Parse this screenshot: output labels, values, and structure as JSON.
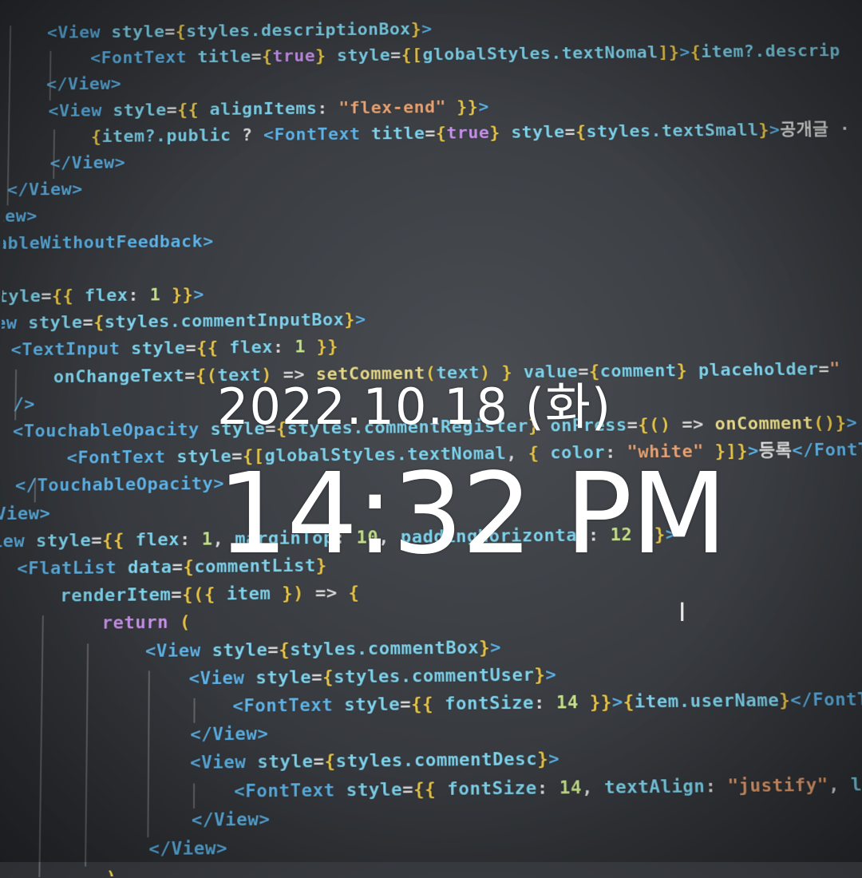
{
  "code_lines": [
    {
      "indent": 52,
      "parts": [
        [
          "tag",
          "<View "
        ],
        [
          "attr",
          "style"
        ],
        [
          "txt",
          "="
        ],
        [
          "brk",
          "{"
        ],
        [
          "attr",
          "styles.descriptionBox"
        ],
        [
          "brk",
          "}"
        ],
        [
          "tag",
          ">"
        ]
      ]
    },
    {
      "indent": 108,
      "parts": [
        [
          "tag",
          "<FontText "
        ],
        [
          "attr",
          "title"
        ],
        [
          "txt",
          "="
        ],
        [
          "brk",
          "{"
        ],
        [
          "kw",
          "true"
        ],
        [
          "brk",
          "}"
        ],
        [
          "txt",
          " "
        ],
        [
          "attr",
          "style"
        ],
        [
          "txt",
          "="
        ],
        [
          "brk",
          "{["
        ],
        [
          "attr",
          "globalStyles.textNomal"
        ],
        [
          "brk",
          "]}"
        ],
        [
          "tag",
          ">"
        ],
        [
          "brk",
          "{"
        ],
        [
          "attr",
          "item?.descrip"
        ]
      ]
    },
    {
      "indent": 52,
      "parts": [
        [
          "tag",
          "</View>"
        ]
      ]
    },
    {
      "indent": 55,
      "parts": [
        [
          "tag",
          "<View "
        ],
        [
          "attr",
          "style"
        ],
        [
          "txt",
          "="
        ],
        [
          "brk",
          "{{"
        ],
        [
          "attr",
          " alignItems"
        ],
        [
          "txt",
          ": "
        ],
        [
          "str",
          "\"flex-end\""
        ],
        [
          "brk",
          " }}"
        ],
        [
          "tag",
          ">"
        ]
      ]
    },
    {
      "indent": 110,
      "parts": [
        [
          "brk",
          "{"
        ],
        [
          "attr",
          "item?.public"
        ],
        [
          "txt",
          " ? "
        ],
        [
          "tag",
          "<FontText "
        ],
        [
          "attr",
          "title"
        ],
        [
          "txt",
          "="
        ],
        [
          "brk",
          "{"
        ],
        [
          "kw",
          "true"
        ],
        [
          "brk",
          "}"
        ],
        [
          "txt",
          " "
        ],
        [
          "attr",
          "style"
        ],
        [
          "txt",
          "="
        ],
        [
          "brk",
          "{"
        ],
        [
          "attr",
          "styles.textSmall"
        ],
        [
          "brk",
          "}"
        ],
        [
          "tag",
          ">"
        ],
        [
          "txt",
          "공개글 ·"
        ]
      ]
    },
    {
      "indent": 58,
      "parts": [
        [
          "tag",
          "</View>"
        ]
      ]
    },
    {
      "indent": 4,
      "parts": [
        [
          "tag",
          "</View>"
        ]
      ]
    },
    {
      "indent": -12,
      "parts": [
        [
          "tag",
          "iew>"
        ]
      ]
    },
    {
      "indent": -8,
      "parts": [
        [
          "tag",
          "ableWithoutFeedback>"
        ]
      ]
    },
    {
      "indent": 0,
      "parts": [
        [
          "txt",
          ""
        ]
      ]
    },
    {
      "indent": -6,
      "parts": [
        [
          "attr",
          "tyle"
        ],
        [
          "txt",
          "="
        ],
        [
          "brk",
          "{{"
        ],
        [
          "attr",
          " flex"
        ],
        [
          "txt",
          ": "
        ],
        [
          "num",
          "1"
        ],
        [
          "brk",
          " }}"
        ],
        [
          "tag",
          ">"
        ]
      ]
    },
    {
      "indent": -8,
      "parts": [
        [
          "tag",
          "ew "
        ],
        [
          "attr",
          "style"
        ],
        [
          "txt",
          "="
        ],
        [
          "brk",
          "{"
        ],
        [
          "attr",
          "styles.commentInputBox"
        ],
        [
          "brk",
          "}"
        ],
        [
          "tag",
          ">"
        ]
      ]
    },
    {
      "indent": 12,
      "parts": [
        [
          "tag",
          "<TextInput "
        ],
        [
          "attr",
          "style"
        ],
        [
          "txt",
          "="
        ],
        [
          "brk",
          "{{"
        ],
        [
          "attr",
          " flex"
        ],
        [
          "txt",
          ": "
        ],
        [
          "num",
          "1"
        ],
        [
          "brk",
          " }}"
        ]
      ]
    },
    {
      "indent": 66,
      "parts": [
        [
          "attr",
          "onChangeText"
        ],
        [
          "txt",
          "="
        ],
        [
          "brk",
          "{("
        ],
        [
          "attr",
          "text"
        ],
        [
          "brk",
          ")"
        ],
        [
          "txt",
          " => "
        ],
        [
          "fn",
          "setComment"
        ],
        [
          "brk",
          "("
        ],
        [
          "attr",
          "text"
        ],
        [
          "brk",
          ")"
        ],
        [
          "brk",
          " }"
        ],
        [
          "txt",
          " "
        ],
        [
          "attr",
          "value"
        ],
        [
          "txt",
          "="
        ],
        [
          "brk",
          "{"
        ],
        [
          "attr",
          "comment"
        ],
        [
          "brk",
          "}"
        ],
        [
          "txt",
          " "
        ],
        [
          "attr",
          "placeholder"
        ],
        [
          "txt",
          "="
        ],
        [
          "str",
          "\""
        ]
      ]
    },
    {
      "indent": 16,
      "parts": [
        [
          "tag",
          "/>"
        ]
      ]
    },
    {
      "indent": 16,
      "parts": [
        [
          "tag",
          "<TouchableOpacity "
        ],
        [
          "attr",
          "style"
        ],
        [
          "txt",
          "="
        ],
        [
          "brk",
          "{"
        ],
        [
          "attr",
          "styles.commentRegister"
        ],
        [
          "brk",
          "}"
        ],
        [
          "txt",
          " "
        ],
        [
          "attr",
          "onPress"
        ],
        [
          "txt",
          "="
        ],
        [
          "brk",
          "{()"
        ],
        [
          "txt",
          " => "
        ],
        [
          "fn",
          "onComment"
        ],
        [
          "brk",
          "()}"
        ],
        [
          "tag",
          ">"
        ]
      ]
    },
    {
      "indent": 84,
      "parts": [
        [
          "tag",
          "<FontText "
        ],
        [
          "attr",
          "style"
        ],
        [
          "txt",
          "="
        ],
        [
          "brk",
          "{["
        ],
        [
          "attr",
          "globalStyles.textNomal"
        ],
        [
          "txt",
          ", "
        ],
        [
          "brk",
          "{"
        ],
        [
          "attr",
          " color"
        ],
        [
          "txt",
          ": "
        ],
        [
          "str",
          "\"white\""
        ],
        [
          "brk",
          " }]}"
        ],
        [
          "tag",
          ">"
        ],
        [
          "txt",
          "등록"
        ],
        [
          "tag",
          "</FontTex"
        ]
      ]
    },
    {
      "indent": 20,
      "parts": [
        [
          "tag",
          "</TouchableOpacity>"
        ]
      ]
    },
    {
      "indent": -4,
      "parts": [
        [
          "tag",
          "View>"
        ]
      ]
    },
    {
      "indent": -8,
      "parts": [
        [
          "tag",
          "iew "
        ],
        [
          "attr",
          "style"
        ],
        [
          "txt",
          "="
        ],
        [
          "brk",
          "{{"
        ],
        [
          "attr",
          " flex"
        ],
        [
          "txt",
          ": "
        ],
        [
          "num",
          "1"
        ],
        [
          "txt",
          ", "
        ],
        [
          "attr",
          "marginTop"
        ],
        [
          "txt",
          ": "
        ],
        [
          "num",
          "10"
        ],
        [
          "txt",
          ", "
        ],
        [
          "attr",
          "paddingHorizontal"
        ],
        [
          "txt",
          ": "
        ],
        [
          "num",
          "12"
        ],
        [
          "brk",
          " }}"
        ],
        [
          "tag",
          ">"
        ]
      ]
    },
    {
      "indent": 24,
      "parts": [
        [
          "tag",
          "<FlatList "
        ],
        [
          "attr",
          "data"
        ],
        [
          "txt",
          "="
        ],
        [
          "brk",
          "{"
        ],
        [
          "attr",
          "commentList"
        ],
        [
          "brk",
          "}"
        ]
      ]
    },
    {
      "indent": 78,
      "parts": [
        [
          "attr",
          "renderItem"
        ],
        [
          "txt",
          "="
        ],
        [
          "brk",
          "{({"
        ],
        [
          "attr",
          " item"
        ],
        [
          "brk",
          " })"
        ],
        [
          "txt",
          " => "
        ],
        [
          "brk",
          "{"
        ]
      ]
    },
    {
      "indent": 130,
      "parts": [
        [
          "kw",
          "return"
        ],
        [
          "brk",
          " ("
        ]
      ]
    },
    {
      "indent": 184,
      "parts": [
        [
          "tag",
          "<View "
        ],
        [
          "attr",
          "style"
        ],
        [
          "txt",
          "="
        ],
        [
          "brk",
          "{"
        ],
        [
          "attr",
          "styles.commentBox"
        ],
        [
          "brk",
          "}"
        ],
        [
          "tag",
          ">"
        ]
      ]
    },
    {
      "indent": 238,
      "parts": [
        [
          "tag",
          "<View "
        ],
        [
          "attr",
          "style"
        ],
        [
          "txt",
          "="
        ],
        [
          "brk",
          "{"
        ],
        [
          "attr",
          "styles.commentUser"
        ],
        [
          "brk",
          "}"
        ],
        [
          "tag",
          ">"
        ]
      ]
    },
    {
      "indent": 292,
      "parts": [
        [
          "tag",
          "<FontText "
        ],
        [
          "attr",
          "style"
        ],
        [
          "txt",
          "="
        ],
        [
          "brk",
          "{{"
        ],
        [
          "attr",
          " fontSize"
        ],
        [
          "txt",
          ": "
        ],
        [
          "num",
          "14"
        ],
        [
          "brk",
          " }}"
        ],
        [
          "tag",
          ">"
        ],
        [
          "brk",
          "{"
        ],
        [
          "attr",
          "item.userName"
        ],
        [
          "brk",
          "}"
        ],
        [
          "tag",
          "</FontText>"
        ]
      ]
    },
    {
      "indent": 240,
      "parts": [
        [
          "tag",
          "</View>"
        ]
      ]
    },
    {
      "indent": 240,
      "parts": [
        [
          "tag",
          "<View "
        ],
        [
          "attr",
          "style"
        ],
        [
          "txt",
          "="
        ],
        [
          "brk",
          "{"
        ],
        [
          "attr",
          "styles.commentDesc"
        ],
        [
          "brk",
          "}"
        ],
        [
          "tag",
          ">"
        ]
      ]
    },
    {
      "indent": 294,
      "parts": [
        [
          "tag",
          "<FontText "
        ],
        [
          "attr",
          "style"
        ],
        [
          "txt",
          "="
        ],
        [
          "brk",
          "{{"
        ],
        [
          "attr",
          " fontSize"
        ],
        [
          "txt",
          ": "
        ],
        [
          "num",
          "14"
        ],
        [
          "txt",
          ", "
        ],
        [
          "attr",
          "textAlign"
        ],
        [
          "txt",
          ": "
        ],
        [
          "str",
          "\"justify\""
        ],
        [
          "txt",
          ", "
        ],
        [
          "attr",
          "lineHe"
        ]
      ]
    },
    {
      "indent": 242,
      "parts": [
        [
          "tag",
          "</View>"
        ]
      ]
    },
    {
      "indent": 190,
      "parts": [
        [
          "tag",
          "</View>"
        ]
      ]
    },
    {
      "indent": 138,
      "parts": [
        [
          "brk",
          ")"
        ]
      ]
    }
  ],
  "overlay": {
    "date": "2022.10.18 (화)",
    "time": "14:32 PM"
  },
  "cursor": {
    "icon": "text-cursor-icon",
    "glyph": "I"
  },
  "colors": {
    "tag": "#5fb3e6",
    "bracket": "#e8c64a",
    "attribute": "#7fd3ec",
    "text": "#dddddd",
    "string": "#e8a273",
    "keyword": "#c792ea",
    "function": "#e6d88a",
    "number": "#c5e08a",
    "overlay_text": "#ffffff"
  }
}
